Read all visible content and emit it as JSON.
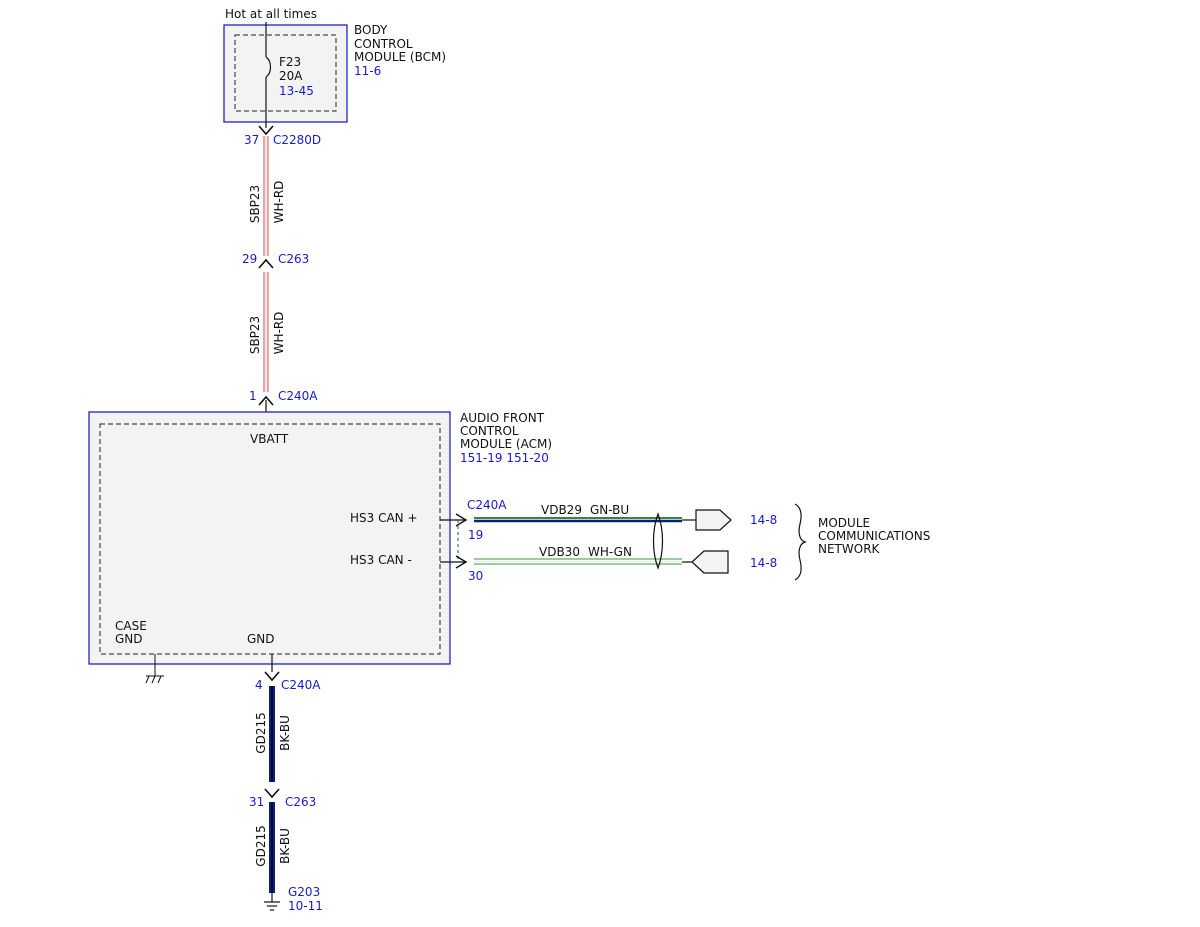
{
  "bcm": {
    "feed_note": "Hot at all times",
    "name_lines": [
      "BODY",
      "CONTROL",
      "MODULE (BCM)"
    ],
    "ref": "11-6",
    "fuse": {
      "id": "F23",
      "rating": "20A",
      "ref": "13-45"
    }
  },
  "wire1": {
    "top_connector": "C2280D",
    "top_pin": "37",
    "circuit": "SBP23",
    "color": "WH-RD",
    "bottom_connector": "C263",
    "bottom_pin": "29"
  },
  "wire2": {
    "circuit": "SBP23",
    "color": "WH-RD",
    "bottom_connector": "C240A",
    "bottom_pin": "1"
  },
  "acm": {
    "name_lines": [
      "AUDIO FRONT",
      "CONTROL",
      "MODULE (ACM)"
    ],
    "refs": "151-19  151-20",
    "vbatt_label": "VBATT",
    "can_plus_label": "HS3 CAN +",
    "can_minus_label": "HS3 CAN -",
    "case_gnd_lines": [
      "CASE",
      "GND"
    ],
    "gnd_label": "GND"
  },
  "can": {
    "connector": "C240A",
    "plus": {
      "pin": "19",
      "circuit": "VDB29",
      "color": "GN-BU",
      "ref": "14-8"
    },
    "minus": {
      "pin": "30",
      "circuit": "VDB30",
      "color": "WH-GN",
      "ref": "14-8"
    },
    "network_lines": [
      "MODULE",
      "COMMUNICATIONS",
      "NETWORK"
    ]
  },
  "ground": {
    "top_connector": "C240A",
    "top_pin": "4",
    "circuit": "GD215",
    "color": "BK-BU",
    "mid_connector": "C263",
    "mid_pin": "31",
    "circuit2": "GD215",
    "color2": "BK-BU",
    "point": "G203",
    "ref": "10-11"
  },
  "colors": {
    "module_border": "#2323c8",
    "ref_text": "#1a1acc",
    "wire_red": "#cc3333",
    "wire_green": "#2e8b3a",
    "wire_blue": "#0f1e78"
  }
}
